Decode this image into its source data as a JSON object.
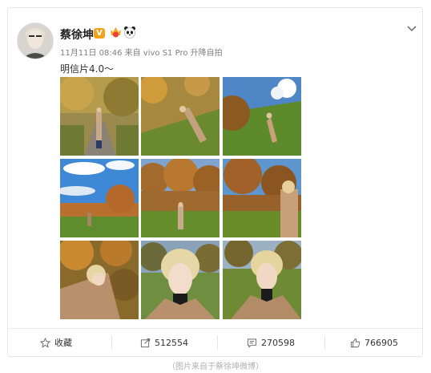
{
  "post": {
    "username": "蔡徐坤",
    "verified_badge": "V",
    "verified_color": "#f2a11a",
    "meta": "11月11日 08:46 来自 vivo S1 Pro 升降自拍",
    "text": "明信片4.0～"
  },
  "icons": {
    "menu": "chevron-down-icon",
    "favorite": "star-icon",
    "repost": "share-icon",
    "comment": "comment-icon",
    "like": "thumbs-up-icon"
  },
  "actions": {
    "favorite_label": "收藏",
    "repost_count": "512554",
    "comment_count": "270598",
    "like_count": "766905"
  },
  "caption": "（图片来自于蔡徐坤微博）"
}
